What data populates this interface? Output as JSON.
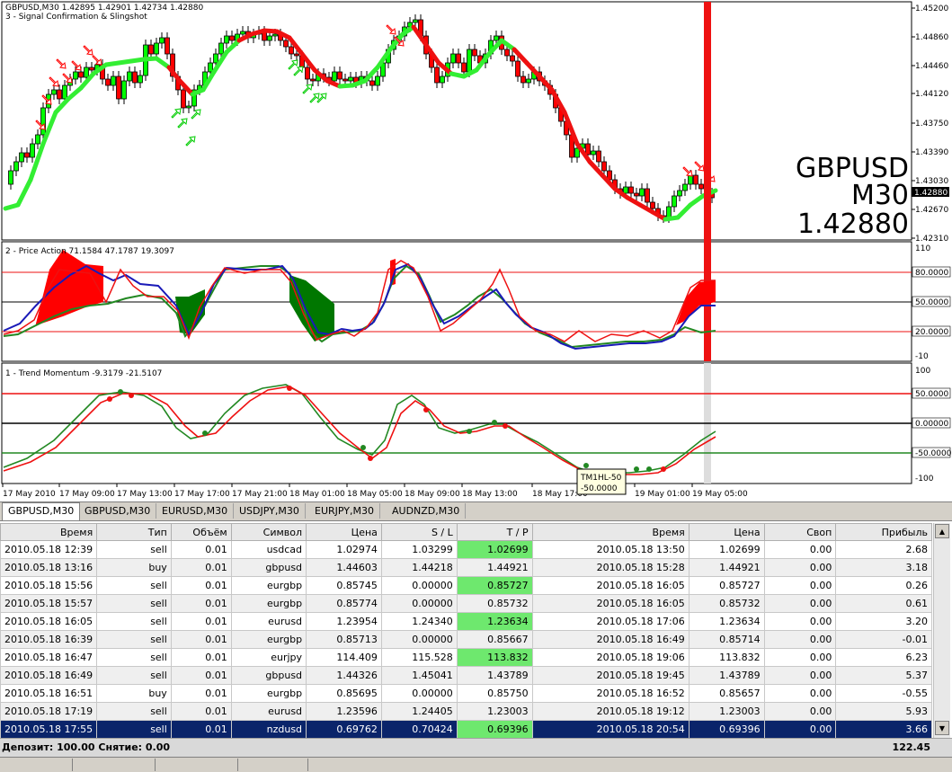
{
  "main_chart": {
    "header": "GBPUSD,M30  1.42895 1.42901 1.42734 1.42880",
    "indicator_name": "3 - Signal Confirmation & Slingshot",
    "big_symbol": "GBPUSD",
    "big_timeframe": "M30",
    "big_price": "1.42880",
    "current_price_label": "1.42880",
    "price_axis": [
      "1.45200",
      "1.44860",
      "1.44460",
      "1.44120",
      "1.43750",
      "1.43390",
      "1.43030",
      "1.42670",
      "1.42310"
    ]
  },
  "price_action": {
    "header": "2 - Price Action 71.1584 47.1787 19.3097",
    "axis": [
      "110",
      "80.0000",
      "50.0000",
      "20.0000",
      "-10"
    ]
  },
  "trend_momentum": {
    "header": "1 - Trend Momentum -9.3179 -21.5107",
    "axis": [
      "100",
      "50.0000",
      "0.00000",
      "-50.0000",
      "-100"
    ],
    "tooltip_line1": "TM1HL-50",
    "tooltip_line2": "-50.0000"
  },
  "time_axis": [
    "17 May 2010",
    "17 May 09:00",
    "17 May 13:00",
    "17 May 17:00",
    "17 May 21:00",
    "18 May 01:00",
    "18 May 05:00",
    "18 May 09:00",
    "18 May 13:00",
    "18 May 17:00",
    "19 May 01:00",
    "19 May 05:00"
  ],
  "chart_tabs": [
    "GBPUSD,M30",
    "GBPUSD,M30",
    "EURUSD,M30",
    "USDJPY,M30",
    "EURJPY,M30",
    "AUDNZD,M30"
  ],
  "columns": [
    "Время",
    "Тип",
    "Объём",
    "Символ",
    "Цена",
    "S / L",
    "T / P",
    "Время",
    "Цена",
    "Своп",
    "Прибыль"
  ],
  "rows": [
    {
      "open": "2010.05.18 12:39",
      "type": "sell",
      "vol": "0.01",
      "sym": "usdcad",
      "price": "1.02974",
      "sl": "1.03299",
      "tp": "1.02699",
      "tp_hit": true,
      "close": "2010.05.18 13:50",
      "cprice": "1.02699",
      "swap": "0.00",
      "profit": "2.68"
    },
    {
      "open": "2010.05.18 13:16",
      "type": "buy",
      "vol": "0.01",
      "sym": "gbpusd",
      "price": "1.44603",
      "sl": "1.44218",
      "tp": "1.44921",
      "tp_hit": true,
      "close": "2010.05.18 15:28",
      "cprice": "1.44921",
      "swap": "0.00",
      "profit": "3.18"
    },
    {
      "open": "2010.05.18 15:56",
      "type": "sell",
      "vol": "0.01",
      "sym": "eurgbp",
      "price": "0.85745",
      "sl": "0.00000",
      "tp": "0.85727",
      "tp_hit": true,
      "close": "2010.05.18 16:05",
      "cprice": "0.85727",
      "swap": "0.00",
      "profit": "0.26"
    },
    {
      "open": "2010.05.18 15:57",
      "type": "sell",
      "vol": "0.01",
      "sym": "eurgbp",
      "price": "0.85774",
      "sl": "0.00000",
      "tp": "0.85732",
      "tp_hit": true,
      "close": "2010.05.18 16:05",
      "cprice": "0.85732",
      "swap": "0.00",
      "profit": "0.61"
    },
    {
      "open": "2010.05.18 16:05",
      "type": "sell",
      "vol": "0.01",
      "sym": "eurusd",
      "price": "1.23954",
      "sl": "1.24340",
      "tp": "1.23634",
      "tp_hit": true,
      "close": "2010.05.18 17:06",
      "cprice": "1.23634",
      "swap": "0.00",
      "profit": "3.20"
    },
    {
      "open": "2010.05.18 16:39",
      "type": "sell",
      "vol": "0.01",
      "sym": "eurgbp",
      "price": "0.85713",
      "sl": "0.00000",
      "tp": "0.85667",
      "tp_hit": false,
      "close": "2010.05.18 16:49",
      "cprice": "0.85714",
      "swap": "0.00",
      "profit": "-0.01"
    },
    {
      "open": "2010.05.18 16:47",
      "type": "sell",
      "vol": "0.01",
      "sym": "eurjpy",
      "price": "114.409",
      "sl": "115.528",
      "tp": "113.832",
      "tp_hit": true,
      "close": "2010.05.18 19:06",
      "cprice": "113.832",
      "swap": "0.00",
      "profit": "6.23"
    },
    {
      "open": "2010.05.18 16:49",
      "type": "sell",
      "vol": "0.01",
      "sym": "gbpusd",
      "price": "1.44326",
      "sl": "1.45041",
      "tp": "1.43789",
      "tp_hit": true,
      "close": "2010.05.18 19:45",
      "cprice": "1.43789",
      "swap": "0.00",
      "profit": "5.37"
    },
    {
      "open": "2010.05.18 16:51",
      "type": "buy",
      "vol": "0.01",
      "sym": "eurgbp",
      "price": "0.85695",
      "sl": "0.00000",
      "tp": "0.85750",
      "tp_hit": false,
      "close": "2010.05.18 16:52",
      "cprice": "0.85657",
      "swap": "0.00",
      "profit": "-0.55"
    },
    {
      "open": "2010.05.18 17:19",
      "type": "sell",
      "vol": "0.01",
      "sym": "eurusd",
      "price": "1.23596",
      "sl": "1.24405",
      "tp": "1.23003",
      "tp_hit": true,
      "close": "2010.05.18 19:12",
      "cprice": "1.23003",
      "swap": "0.00",
      "profit": "5.93"
    },
    {
      "open": "2010.05.18 17:55",
      "type": "sell",
      "vol": "0.01",
      "sym": "nzdusd",
      "price": "0.69762",
      "sl": "0.70424",
      "tp": "0.69396",
      "tp_hit": true,
      "close": "2010.05.18 20:54",
      "cprice": "0.69396",
      "swap": "0.00",
      "profit": "3.66",
      "selected": true
    }
  ],
  "footer": {
    "left": "Депозит: 100.00  Снятие: 0.00",
    "total": "122.45"
  },
  "colors": {
    "bull": "#00ff00",
    "bear": "#ff0000",
    "trend_up": "#33ee33",
    "trend_down": "#ee1111",
    "selected_row": "#0a246a",
    "tp_hit": "#6ee86e"
  }
}
